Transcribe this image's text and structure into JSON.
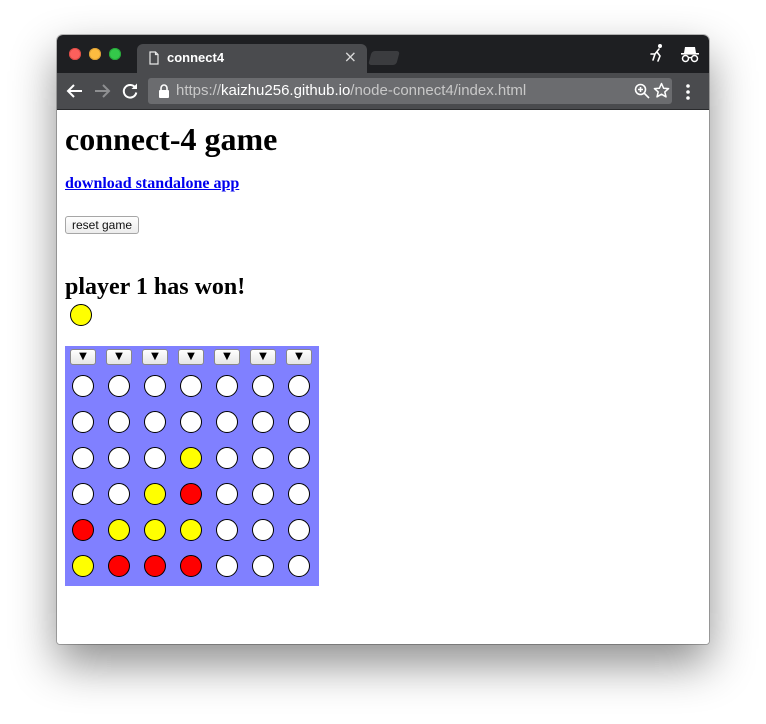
{
  "browser": {
    "tab_title": "connect4",
    "tab_close": "×",
    "url_scheme": "https://",
    "url_host": "kaizhu256.github.io",
    "url_path": "/node-connect4/index.html"
  },
  "page": {
    "title": "connect-4 game",
    "download_link": "download standalone app",
    "reset_button": "reset game",
    "status": "player 1 has won!",
    "current_piece": "yellow"
  },
  "board": {
    "drop_arrow": "▼",
    "columns": 7,
    "rows": 6,
    "colors": {
      "empty": "#ffffff",
      "yellow": "#ffff00",
      "red": "#ff0000",
      "board": "#8080ff"
    },
    "grid": [
      [
        "empty",
        "empty",
        "empty",
        "empty",
        "empty",
        "empty",
        "empty"
      ],
      [
        "empty",
        "empty",
        "empty",
        "empty",
        "empty",
        "empty",
        "empty"
      ],
      [
        "empty",
        "empty",
        "empty",
        "yellow",
        "empty",
        "empty",
        "empty"
      ],
      [
        "empty",
        "empty",
        "yellow",
        "red",
        "empty",
        "empty",
        "empty"
      ],
      [
        "red",
        "yellow",
        "yellow",
        "yellow",
        "empty",
        "empty",
        "empty"
      ],
      [
        "yellow",
        "red",
        "red",
        "red",
        "empty",
        "empty",
        "empty"
      ]
    ]
  }
}
